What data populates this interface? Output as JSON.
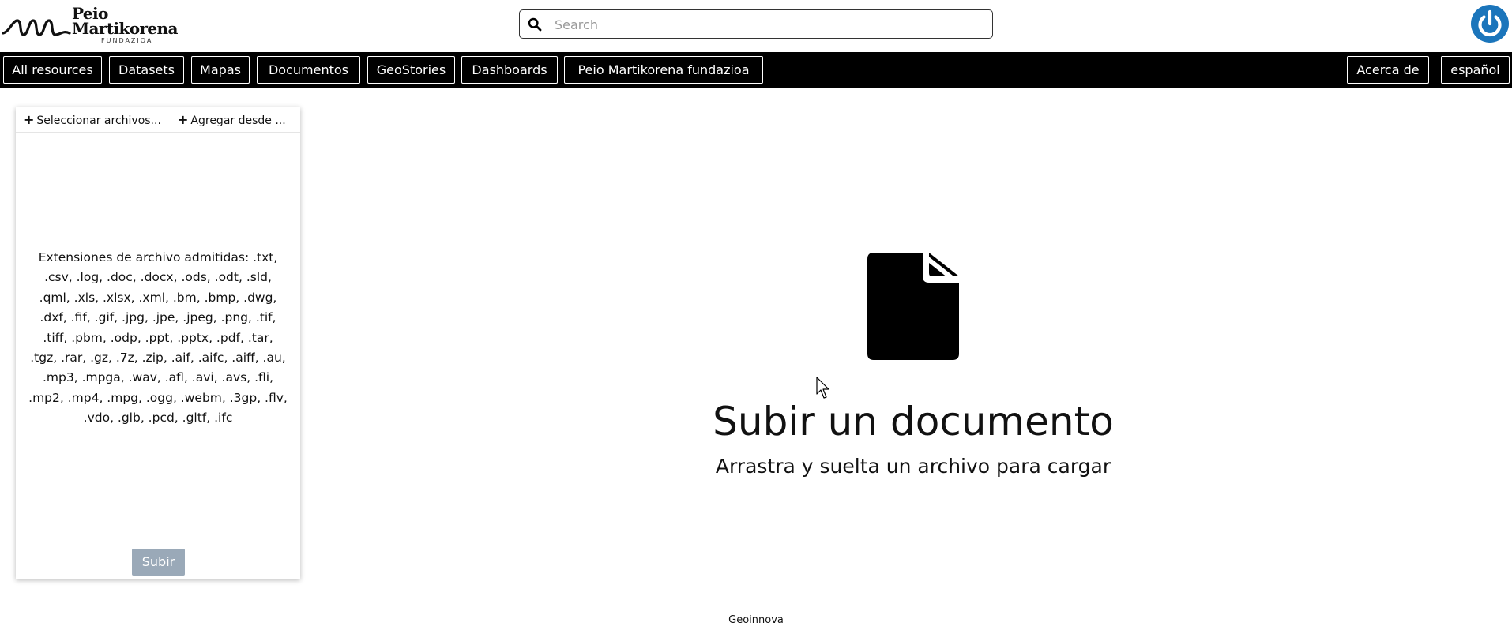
{
  "logo": {
    "line1": "Peio",
    "line2": "Martikorena",
    "line3": "FUNDAZIOA"
  },
  "search": {
    "placeholder": "Search",
    "value": ""
  },
  "user_menu": {
    "icon": "power-icon",
    "color": "#1b75bb"
  },
  "nav": {
    "left": [
      {
        "label": "All resources"
      },
      {
        "label": "Datasets"
      },
      {
        "label": "Mapas"
      },
      {
        "label": "Documentos"
      },
      {
        "label": "GeoStories"
      },
      {
        "label": "Dashboards"
      },
      {
        "label": "Peio Martikorena fundazioa"
      }
    ],
    "right": [
      {
        "label": "Acerca de"
      },
      {
        "label": "español"
      }
    ]
  },
  "upload_panel": {
    "select_files_label": "Seleccionar archivos...",
    "add_from_label": "Agregar desde ...",
    "supported_extensions": "Extensiones de archivo admitidas: .txt, .csv, .log, .doc, .docx, .ods, .odt, .sld, .qml, .xls, .xlsx, .xml, .bm, .bmp, .dwg, .dxf, .fif, .gif, .jpg, .jpe, .jpeg, .png, .tif, .tiff, .pbm, .odp, .ppt, .pptx, .pdf, .tar, .tgz, .rar, .gz, .7z, .zip, .aif, .aifc, .aiff, .au, .mp3, .mpga, .wav, .afl, .avi, .avs, .fli, .mp2, .mp4, .mpg, .ogg, .webm, .3gp, .flv, .vdo, .glb, .pcd, .gltf, .ifc",
    "submit_label": "Subir",
    "submit_color": "#9aa9b8"
  },
  "drop_zone": {
    "icon": "document-icon",
    "title": "Subir un documento",
    "subtitle": "Arrastra y suelta un archivo para cargar"
  },
  "footer": {
    "text": "Geoinnova"
  }
}
